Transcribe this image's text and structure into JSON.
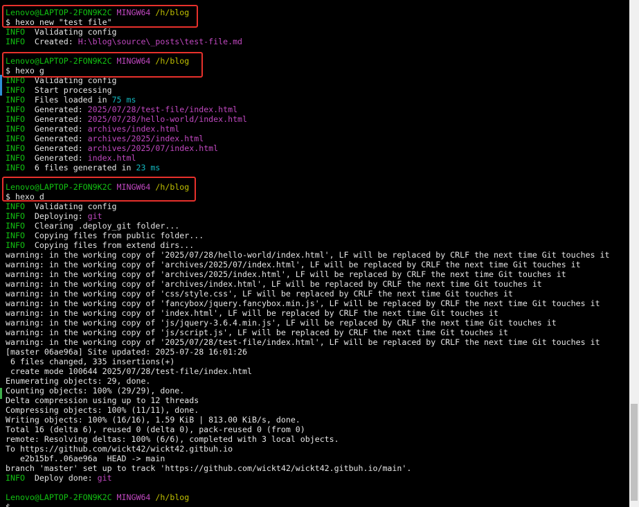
{
  "colors": {
    "background": "#000000",
    "text": "#e6e6e6",
    "user_host": "#12c312",
    "shell": "#c048c0",
    "path": "#c0c000",
    "info": "#12c312",
    "number": "#12b8c0",
    "file": "#c048c0",
    "highlight_box": "#e8312c"
  },
  "lines": [
    {
      "segs": [
        {
          "t": "Lenovo@LAPTOP-2FON9K2C",
          "c": "green"
        },
        {
          "t": " "
        },
        {
          "t": "MINGW64",
          "c": "purple"
        },
        {
          "t": " "
        },
        {
          "t": "/h/blog",
          "c": "olive"
        }
      ]
    },
    {
      "segs": [
        {
          "t": "$ hexo new \"test_file\""
        }
      ]
    },
    {
      "segs": [
        {
          "t": "INFO",
          "c": "green"
        },
        {
          "t": "  Validating config"
        }
      ]
    },
    {
      "segs": [
        {
          "t": "INFO",
          "c": "green"
        },
        {
          "t": "  Created: "
        },
        {
          "t": "H:\\blog\\source\\_posts\\test-file.md",
          "c": "magenta"
        }
      ]
    },
    {
      "segs": [
        {
          "t": ""
        }
      ]
    },
    {
      "segs": [
        {
          "t": "Lenovo@LAPTOP-2FON9K2C",
          "c": "green"
        },
        {
          "t": " "
        },
        {
          "t": "MINGW64",
          "c": "purple"
        },
        {
          "t": " "
        },
        {
          "t": "/h/blog",
          "c": "olive"
        }
      ]
    },
    {
      "segs": [
        {
          "t": "$ hexo g"
        }
      ]
    },
    {
      "segs": [
        {
          "t": "INFO",
          "c": "green"
        },
        {
          "t": "  Validating config"
        }
      ]
    },
    {
      "segs": [
        {
          "t": "INFO",
          "c": "green"
        },
        {
          "t": "  Start processing"
        }
      ]
    },
    {
      "segs": [
        {
          "t": "INFO",
          "c": "green"
        },
        {
          "t": "  Files loaded in "
        },
        {
          "t": "75 ms",
          "c": "cyan"
        }
      ]
    },
    {
      "segs": [
        {
          "t": "INFO",
          "c": "green"
        },
        {
          "t": "  Generated: "
        },
        {
          "t": "2025/07/28/test-file/index.html",
          "c": "magenta"
        }
      ]
    },
    {
      "segs": [
        {
          "t": "INFO",
          "c": "green"
        },
        {
          "t": "  Generated: "
        },
        {
          "t": "2025/07/28/hello-world/index.html",
          "c": "magenta"
        }
      ]
    },
    {
      "segs": [
        {
          "t": "INFO",
          "c": "green"
        },
        {
          "t": "  Generated: "
        },
        {
          "t": "archives/index.html",
          "c": "magenta"
        }
      ]
    },
    {
      "segs": [
        {
          "t": "INFO",
          "c": "green"
        },
        {
          "t": "  Generated: "
        },
        {
          "t": "archives/2025/index.html",
          "c": "magenta"
        }
      ]
    },
    {
      "segs": [
        {
          "t": "INFO",
          "c": "green"
        },
        {
          "t": "  Generated: "
        },
        {
          "t": "archives/2025/07/index.html",
          "c": "magenta"
        }
      ]
    },
    {
      "segs": [
        {
          "t": "INFO",
          "c": "green"
        },
        {
          "t": "  Generated: "
        },
        {
          "t": "index.html",
          "c": "magenta"
        }
      ]
    },
    {
      "segs": [
        {
          "t": "INFO",
          "c": "green"
        },
        {
          "t": "  6 files generated in "
        },
        {
          "t": "23 ms",
          "c": "cyan"
        }
      ]
    },
    {
      "segs": [
        {
          "t": ""
        }
      ]
    },
    {
      "segs": [
        {
          "t": "Lenovo@LAPTOP-2FON9K2C",
          "c": "green"
        },
        {
          "t": " "
        },
        {
          "t": "MINGW64",
          "c": "purple"
        },
        {
          "t": " "
        },
        {
          "t": "/h/blog",
          "c": "olive"
        }
      ]
    },
    {
      "segs": [
        {
          "t": "$ hexo d"
        }
      ]
    },
    {
      "segs": [
        {
          "t": "INFO",
          "c": "green"
        },
        {
          "t": "  Validating config"
        }
      ]
    },
    {
      "segs": [
        {
          "t": "INFO",
          "c": "green"
        },
        {
          "t": "  Deploying: "
        },
        {
          "t": "git",
          "c": "magenta"
        }
      ]
    },
    {
      "segs": [
        {
          "t": "INFO",
          "c": "green"
        },
        {
          "t": "  Clearing .deploy_git folder..."
        }
      ]
    },
    {
      "segs": [
        {
          "t": "INFO",
          "c": "green"
        },
        {
          "t": "  Copying files from public folder..."
        }
      ]
    },
    {
      "segs": [
        {
          "t": "INFO",
          "c": "green"
        },
        {
          "t": "  Copying files from extend dirs..."
        }
      ]
    },
    {
      "segs": [
        {
          "t": "warning: in the working copy of '2025/07/28/hello-world/index.html', LF will be replaced by CRLF the next time Git touches it"
        }
      ]
    },
    {
      "segs": [
        {
          "t": "warning: in the working copy of 'archives/2025/07/index.html', LF will be replaced by CRLF the next time Git touches it"
        }
      ]
    },
    {
      "segs": [
        {
          "t": "warning: in the working copy of 'archives/2025/index.html', LF will be replaced by CRLF the next time Git touches it"
        }
      ]
    },
    {
      "segs": [
        {
          "t": "warning: in the working copy of 'archives/index.html', LF will be replaced by CRLF the next time Git touches it"
        }
      ]
    },
    {
      "segs": [
        {
          "t": "warning: in the working copy of 'css/style.css', LF will be replaced by CRLF the next time Git touches it"
        }
      ]
    },
    {
      "segs": [
        {
          "t": "warning: in the working copy of 'fancybox/jquery.fancybox.min.js', LF will be replaced by CRLF the next time Git touches it"
        }
      ]
    },
    {
      "segs": [
        {
          "t": "warning: in the working copy of 'index.html', LF will be replaced by CRLF the next time Git touches it"
        }
      ]
    },
    {
      "segs": [
        {
          "t": "warning: in the working copy of 'js/jquery-3.6.4.min.js', LF will be replaced by CRLF the next time Git touches it"
        }
      ]
    },
    {
      "segs": [
        {
          "t": "warning: in the working copy of 'js/script.js', LF will be replaced by CRLF the next time Git touches it"
        }
      ]
    },
    {
      "segs": [
        {
          "t": "warning: in the working copy of '2025/07/28/test-file/index.html', LF will be replaced by CRLF the next time Git touches it"
        }
      ]
    },
    {
      "segs": [
        {
          "t": "[master 06ae96a] Site updated: 2025-07-28 16:01:26"
        }
      ]
    },
    {
      "segs": [
        {
          "t": " 6 files changed, 335 insertions(+)"
        }
      ]
    },
    {
      "segs": [
        {
          "t": " create mode 100644 2025/07/28/test-file/index.html"
        }
      ]
    },
    {
      "segs": [
        {
          "t": "Enumerating objects: 29, done."
        }
      ]
    },
    {
      "segs": [
        {
          "t": "Counting objects: 100% (29/29), done."
        }
      ]
    },
    {
      "segs": [
        {
          "t": "Delta compression using up to 12 threads"
        }
      ]
    },
    {
      "segs": [
        {
          "t": "Compressing objects: 100% (11/11), done."
        }
      ]
    },
    {
      "segs": [
        {
          "t": "Writing objects: 100% (16/16), 1.59 KiB | 813.00 KiB/s, done."
        }
      ]
    },
    {
      "segs": [
        {
          "t": "Total 16 (delta 6), reused 0 (delta 0), pack-reused 0 (from 0)"
        }
      ]
    },
    {
      "segs": [
        {
          "t": "remote: Resolving deltas: 100% (6/6), completed with 3 local objects."
        }
      ]
    },
    {
      "segs": [
        {
          "t": "To https://github.com/wickt42/wickt42.gitbuh.io"
        }
      ]
    },
    {
      "segs": [
        {
          "t": "   e2b15bf..06ae96a  HEAD -> main"
        }
      ]
    },
    {
      "segs": [
        {
          "t": "branch 'master' set up to track 'https://github.com/wickt42/wickt42.gitbuh.io/main'."
        }
      ]
    },
    {
      "segs": [
        {
          "t": "INFO",
          "c": "green"
        },
        {
          "t": "  Deploy done: "
        },
        {
          "t": "git",
          "c": "magenta"
        }
      ]
    },
    {
      "segs": [
        {
          "t": ""
        }
      ]
    },
    {
      "segs": [
        {
          "t": "Lenovo@LAPTOP-2FON9K2C",
          "c": "green"
        },
        {
          "t": " "
        },
        {
          "t": "MINGW64",
          "c": "purple"
        },
        {
          "t": " "
        },
        {
          "t": "/h/blog",
          "c": "olive"
        }
      ]
    },
    {
      "segs": [
        {
          "t": "$"
        }
      ]
    }
  ]
}
